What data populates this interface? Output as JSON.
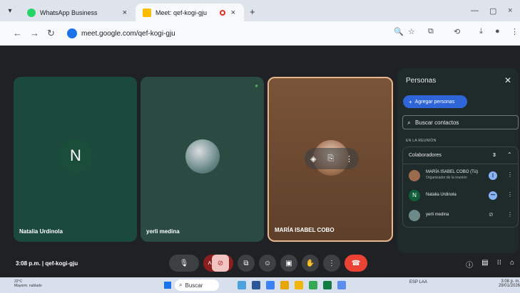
{
  "browser": {
    "tabs": [
      {
        "title": "WhatsApp Business",
        "active": false
      },
      {
        "title": "Meet: qef-kogi-gju",
        "active": true
      }
    ],
    "url": "meet.google.com/qef-kogi-gju",
    "new_tab": "+",
    "window_buttons": [
      "—",
      "▢",
      "×"
    ]
  },
  "meeting": {
    "tiles": [
      {
        "name": "Natalia Urdinola",
        "avatar_letter": "N"
      },
      {
        "name": "yerli medina"
      },
      {
        "name": "MARÍA ISABEL COBO"
      }
    ],
    "time": "3:08 p.m.",
    "code": "qef-kogi-gju"
  },
  "people_panel": {
    "title": "Personas",
    "add_button": "Agregar personas",
    "search_placeholder": "Buscar contactos",
    "section_label": "EN LA REUNIÓN",
    "group_title": "Colaboradores",
    "group_count": "3",
    "participants": [
      {
        "name": "MARÍA ISABEL COBO (Tú)",
        "subtitle": "Organizador de la reunión"
      },
      {
        "name": "Natalia Urdinola",
        "avatar_letter": "N"
      },
      {
        "name": "yerli medina"
      }
    ]
  },
  "taskbar": {
    "weather_temp": "22°C",
    "weather_desc": "Mayorm. nublado",
    "search": "Buscar",
    "lang": "ESP",
    "lang2": "LAA",
    "time": "3:08 p. m.",
    "date": "29/01/2026"
  },
  "colors": {
    "accent": "#1a73e8",
    "panel": "#1f2b2a",
    "leave": "#ea4335"
  }
}
